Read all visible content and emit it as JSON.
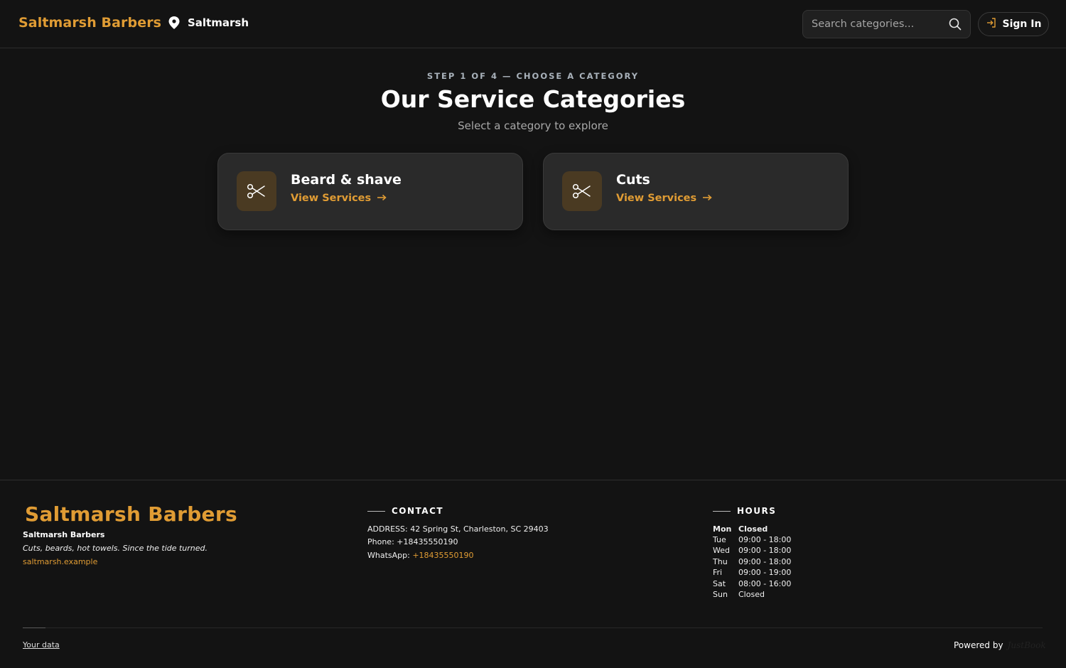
{
  "header": {
    "brand": "Saltmarsh Barbers",
    "location": "Saltmarsh",
    "search_placeholder": "Search categories...",
    "signin_label": "Sign In"
  },
  "main": {
    "eyebrow": "STEP 1 OF 4 — CHOOSE A CATEGORY",
    "title": "Our Service Categories",
    "subtitle": "Select a category to explore",
    "categories": [
      {
        "name": "Beard & shave",
        "link": "View Services",
        "icon": "scissors-icon"
      },
      {
        "name": "Cuts",
        "link": "View Services",
        "icon": "scissors-icon"
      }
    ]
  },
  "footer": {
    "logo": "Saltmarsh Barbers",
    "name": "Saltmarsh Barbers",
    "tagline": "Cuts, beards, hot towels. Since the tide turned.",
    "website": "saltmarsh.example",
    "contact_heading": "CONTACT",
    "address": "ADDRESS: 42 Spring St, Charleston, SC 29403",
    "phone": "Phone: +18435550190",
    "whatsapp_label": "WhatsApp: ",
    "whatsapp_number": "+18435550190",
    "hours_heading": "HOURS",
    "hours": [
      {
        "day": "Mon",
        "time": "Closed"
      },
      {
        "day": "Tue",
        "time": "09:00 - 18:00"
      },
      {
        "day": "Wed",
        "time": "09:00 - 18:00"
      },
      {
        "day": "Thu",
        "time": "09:00 - 18:00"
      },
      {
        "day": "Fri",
        "time": "09:00 - 19:00"
      },
      {
        "day": "Sat",
        "time": "08:00 - 16:00"
      },
      {
        "day": "Sun",
        "time": "Closed"
      }
    ],
    "your_data": "Your data",
    "powered_by": "Powered by",
    "powered_brand": "JustBook"
  },
  "colors": {
    "accent": "#e09c34",
    "background": "#131313",
    "card": "#2a2a2a",
    "icon_tile": "#4a3a22"
  }
}
